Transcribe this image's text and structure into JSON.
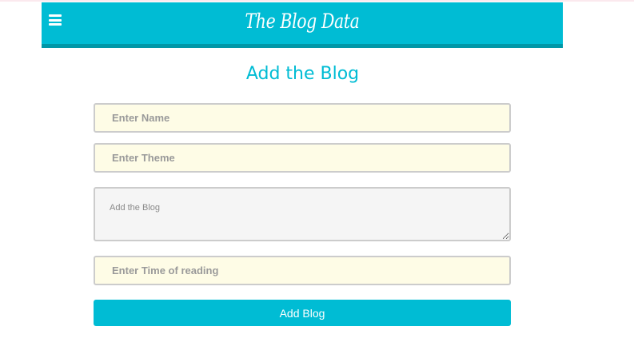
{
  "header": {
    "brand": "The Blog Data",
    "menu_icon": "hamburger-menu-icon"
  },
  "form": {
    "title": "Add the Blog",
    "name_placeholder": "Enter Name",
    "theme_placeholder": "Enter Theme",
    "blog_placeholder": "Add the Blog",
    "time_placeholder": "Enter Time of reading",
    "submit_label": "Add Blog"
  },
  "colors": {
    "accent": "#00bcd4",
    "accent_dark": "#0097a7",
    "input_background": "#fefce6",
    "textarea_background": "#f5f5f5"
  }
}
